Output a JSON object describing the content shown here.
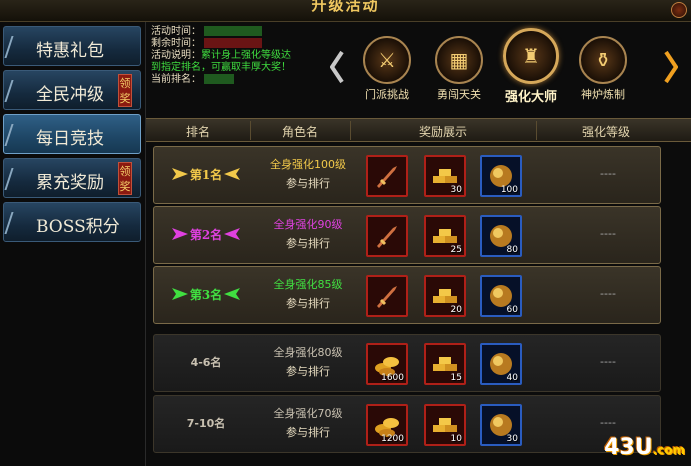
{
  "window": {
    "title": "升级活动"
  },
  "sidebar": {
    "items": [
      {
        "label": "特惠礼包",
        "badge": ""
      },
      {
        "label": "全民冲级",
        "badge": "领奖"
      },
      {
        "label": "每日竞技",
        "badge": ""
      },
      {
        "label": "累充奖励",
        "badge": "领奖"
      },
      {
        "label": "BOSS积分",
        "badge": ""
      }
    ],
    "active_index": 2
  },
  "info": {
    "time_label": "活动时间：",
    "remain_label": "剩余时间：",
    "desc_label": "活动说明：",
    "desc_text_1": "累计身上强化等级达",
    "desc_text_2": "到指定排名，可赢取丰厚大奖！",
    "rank_label": "当前排名："
  },
  "events": [
    {
      "label": "门派挑战",
      "icon": "crossed-swords-icon"
    },
    {
      "label": "勇闯天关",
      "icon": "chest-icon"
    },
    {
      "label": "强化大师",
      "icon": "forge-tower-icon"
    },
    {
      "label": "神炉炼制",
      "icon": "furnace-icon"
    }
  ],
  "active_event": 2,
  "table": {
    "headers": [
      "排名",
      "角色名",
      "奖励展示",
      "强化等级"
    ],
    "rows": [
      {
        "rank": "第1名",
        "req": "全身强化100级",
        "note": "参与排行",
        "rewards": [
          {
            "count": ""
          },
          {
            "count": "30"
          },
          {
            "count": "100"
          }
        ],
        "level": "----",
        "color": "#f2c94a"
      },
      {
        "rank": "第2名",
        "req": "全身强化90级",
        "note": "参与排行",
        "rewards": [
          {
            "count": ""
          },
          {
            "count": "25"
          },
          {
            "count": "80"
          }
        ],
        "level": "----",
        "color": "#e040e0"
      },
      {
        "rank": "第3名",
        "req": "全身强化85级",
        "note": "参与排行",
        "rewards": [
          {
            "count": ""
          },
          {
            "count": "20"
          },
          {
            "count": "60"
          }
        ],
        "level": "----",
        "color": "#40e040"
      },
      {
        "rank": "4-6名",
        "req": "全身强化80级",
        "note": "参与排行",
        "rewards": [
          {
            "count": "1600"
          },
          {
            "count": "15"
          },
          {
            "count": "40"
          }
        ],
        "level": "----",
        "color": "#c8c0b0"
      },
      {
        "rank": "7-10名",
        "req": "全身强化70级",
        "note": "参与排行",
        "rewards": [
          {
            "count": "1200"
          },
          {
            "count": "10"
          },
          {
            "count": "30"
          }
        ],
        "level": "----",
        "color": "#c8c0b0"
      }
    ]
  },
  "watermark": {
    "main": "43U",
    "suffix": ".com"
  }
}
